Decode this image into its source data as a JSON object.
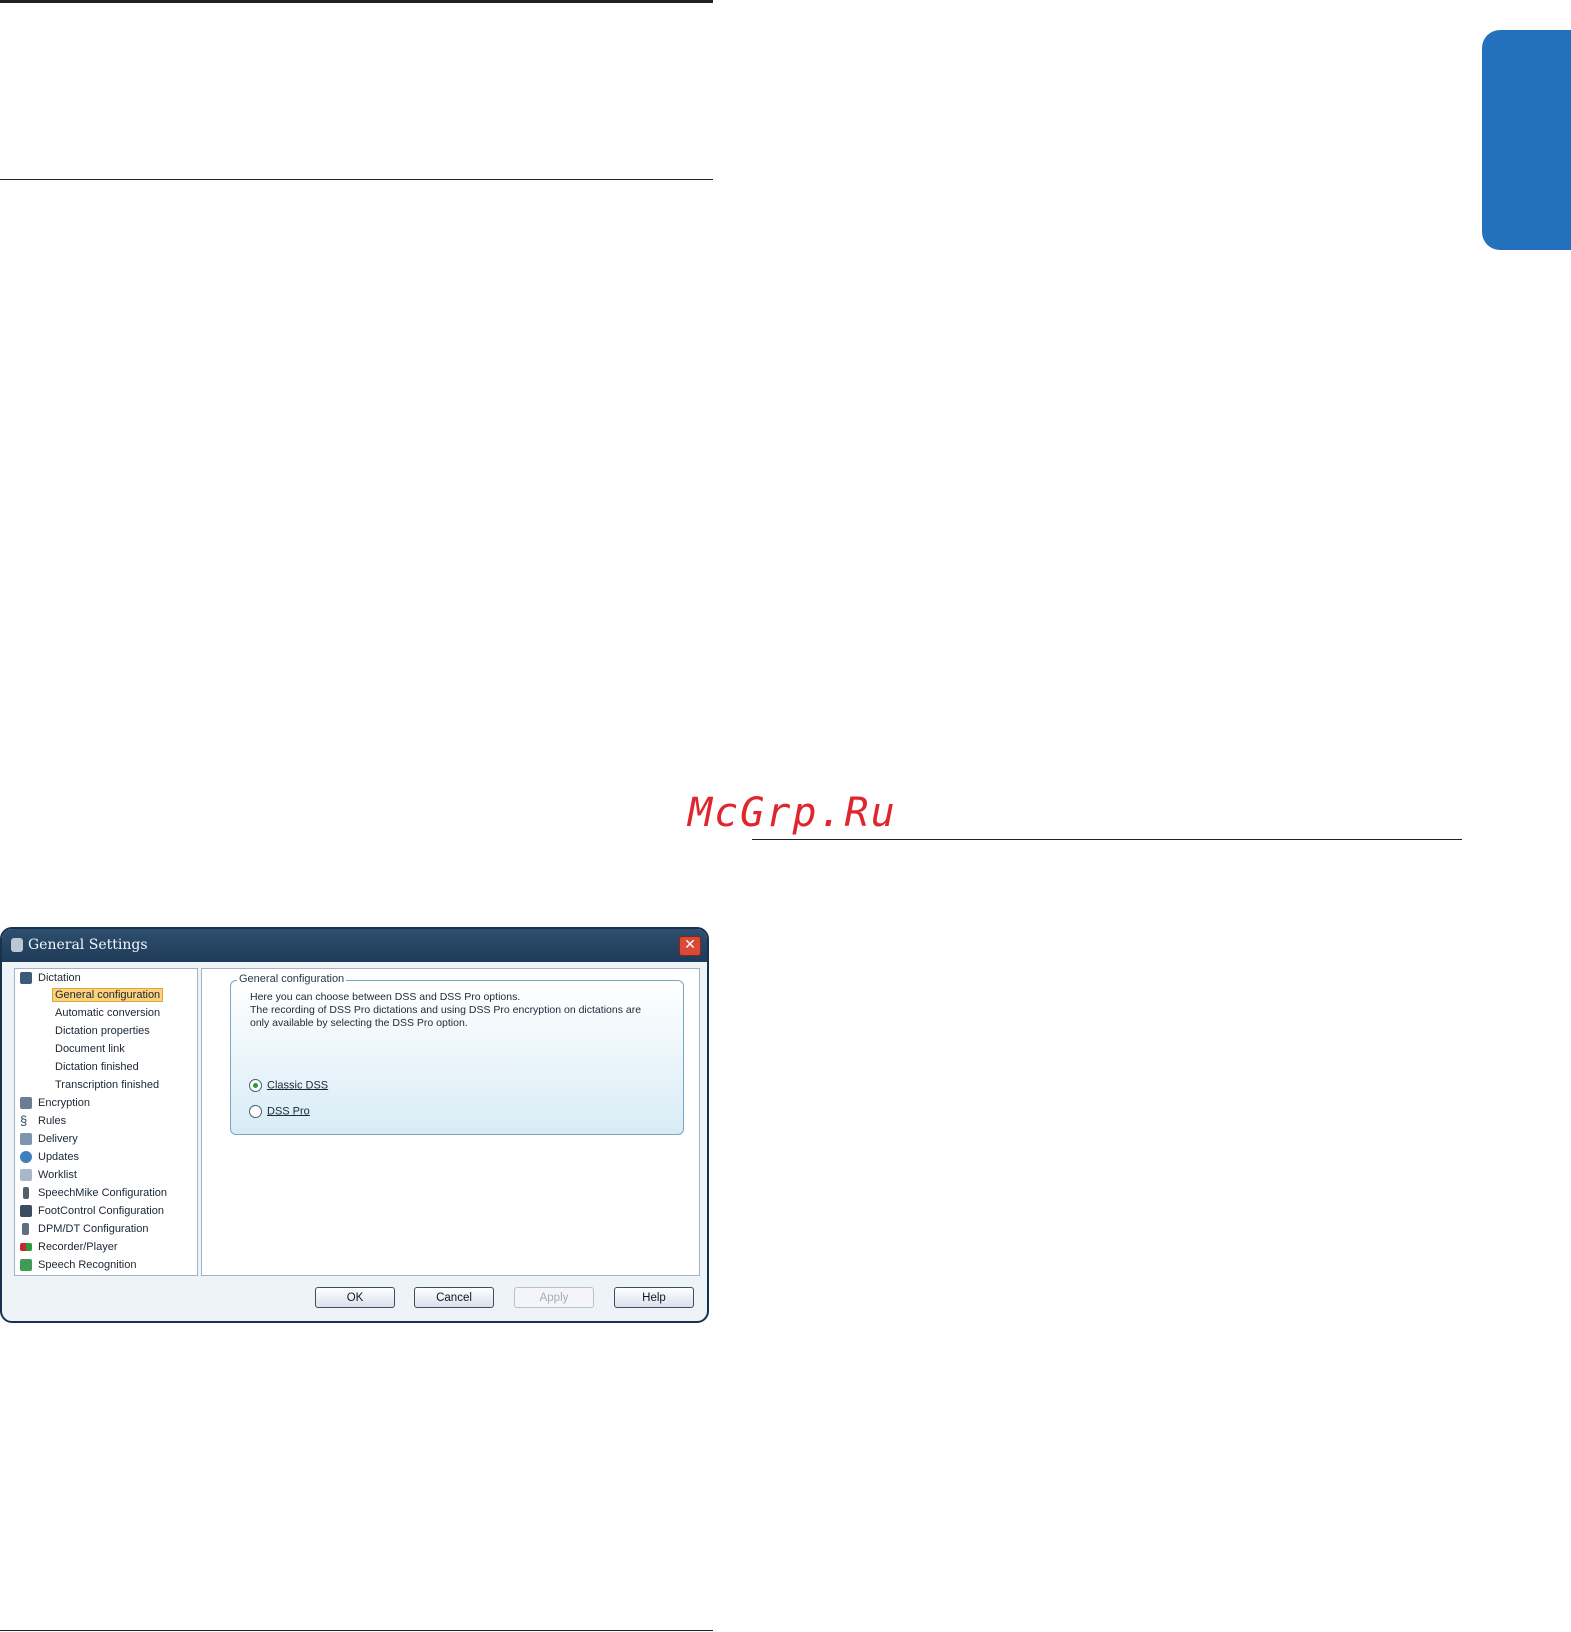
{
  "watermark": "McGrp.Ru",
  "dialog": {
    "title": "General Settings",
    "close_glyph": "✕",
    "tree": [
      {
        "label": "Dictation",
        "icon": "dictation-icon",
        "level": 0
      },
      {
        "label": "General configuration",
        "icon": null,
        "level": 1,
        "selected": true
      },
      {
        "label": "Automatic conversion",
        "icon": null,
        "level": 1
      },
      {
        "label": "Dictation properties",
        "icon": null,
        "level": 1
      },
      {
        "label": "Document link",
        "icon": null,
        "level": 1
      },
      {
        "label": "Dictation finished",
        "icon": null,
        "level": 1
      },
      {
        "label": "Transcription finished",
        "icon": null,
        "level": 1
      },
      {
        "label": "Encryption",
        "icon": "lock-icon",
        "level": 0
      },
      {
        "label": "Rules",
        "icon": "section-icon",
        "level": 0
      },
      {
        "label": "Delivery",
        "icon": "delivery-icon",
        "level": 0
      },
      {
        "label": "Updates",
        "icon": "globe-icon",
        "level": 0
      },
      {
        "label": "Worklist",
        "icon": "list-icon",
        "level": 0
      },
      {
        "label": "SpeechMike Configuration",
        "icon": "speechmike-icon",
        "level": 0
      },
      {
        "label": "FootControl Configuration",
        "icon": "footcontrol-icon",
        "level": 0
      },
      {
        "label": "DPM/DT Configuration",
        "icon": "recorder-device-icon",
        "level": 0
      },
      {
        "label": "Recorder/Player",
        "icon": "record-play-icon",
        "level": 0
      },
      {
        "label": "Speech Recognition",
        "icon": "speech-recognition-icon",
        "level": 0
      }
    ],
    "group": {
      "legend": "General configuration",
      "description_lines": [
        "Here you can choose between DSS and DSS Pro options.",
        "The recording of DSS Pro dictations and using DSS Pro encryption on dictations are",
        "only available by selecting the DSS Pro option."
      ],
      "options": [
        {
          "label": "Classic DSS",
          "checked": true
        },
        {
          "label": "DSS Pro",
          "checked": false
        }
      ]
    },
    "buttons": {
      "ok": "OK",
      "cancel": "Cancel",
      "apply": "Apply",
      "help": "Help"
    }
  }
}
